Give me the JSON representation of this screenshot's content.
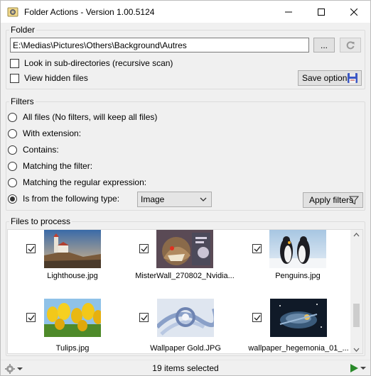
{
  "window": {
    "title": "Folder Actions - Version 1.00.5124"
  },
  "folder": {
    "group_label": "Folder",
    "path": "E:\\Medias\\Pictures\\Others\\Background\\Autres",
    "browse_label": "...",
    "sub_dirs_label": "Look in sub-directories (recursive scan)",
    "hidden_files_label": "View hidden files",
    "save_options_label": "Save options"
  },
  "filters": {
    "group_label": "Filters",
    "options": [
      {
        "label": "All files (No filters, will keep all files)",
        "selected": false
      },
      {
        "label": "With extension:",
        "selected": false
      },
      {
        "label": "Contains:",
        "selected": false
      },
      {
        "label": "Matching the filter:",
        "selected": false
      },
      {
        "label": "Matching the regular expression:",
        "selected": false
      },
      {
        "label": "Is from the following type:",
        "selected": true
      }
    ],
    "type_value": "Image",
    "apply_label": "Apply filters"
  },
  "files": {
    "group_label": "Files to process",
    "items": [
      {
        "name": "Lighthouse.jpg",
        "checked": true
      },
      {
        "name": "MisterWall_270802_Nvidia...",
        "checked": true
      },
      {
        "name": "Penguins.jpg",
        "checked": true
      },
      {
        "name": "Tulips.jpg",
        "checked": true
      },
      {
        "name": "Wallpaper Gold.JPG",
        "checked": true
      },
      {
        "name": "wallpaper_hegemonia_01_...",
        "checked": true
      }
    ]
  },
  "status": {
    "text": "19 items selected"
  },
  "icons": {
    "app": "settings-gear-icon",
    "refresh": "refresh-icon",
    "save": "floppy-disk-icon",
    "filter": "funnel-icon",
    "run": "play-icon"
  },
  "colors": {
    "accent": "#2a8a2a"
  }
}
